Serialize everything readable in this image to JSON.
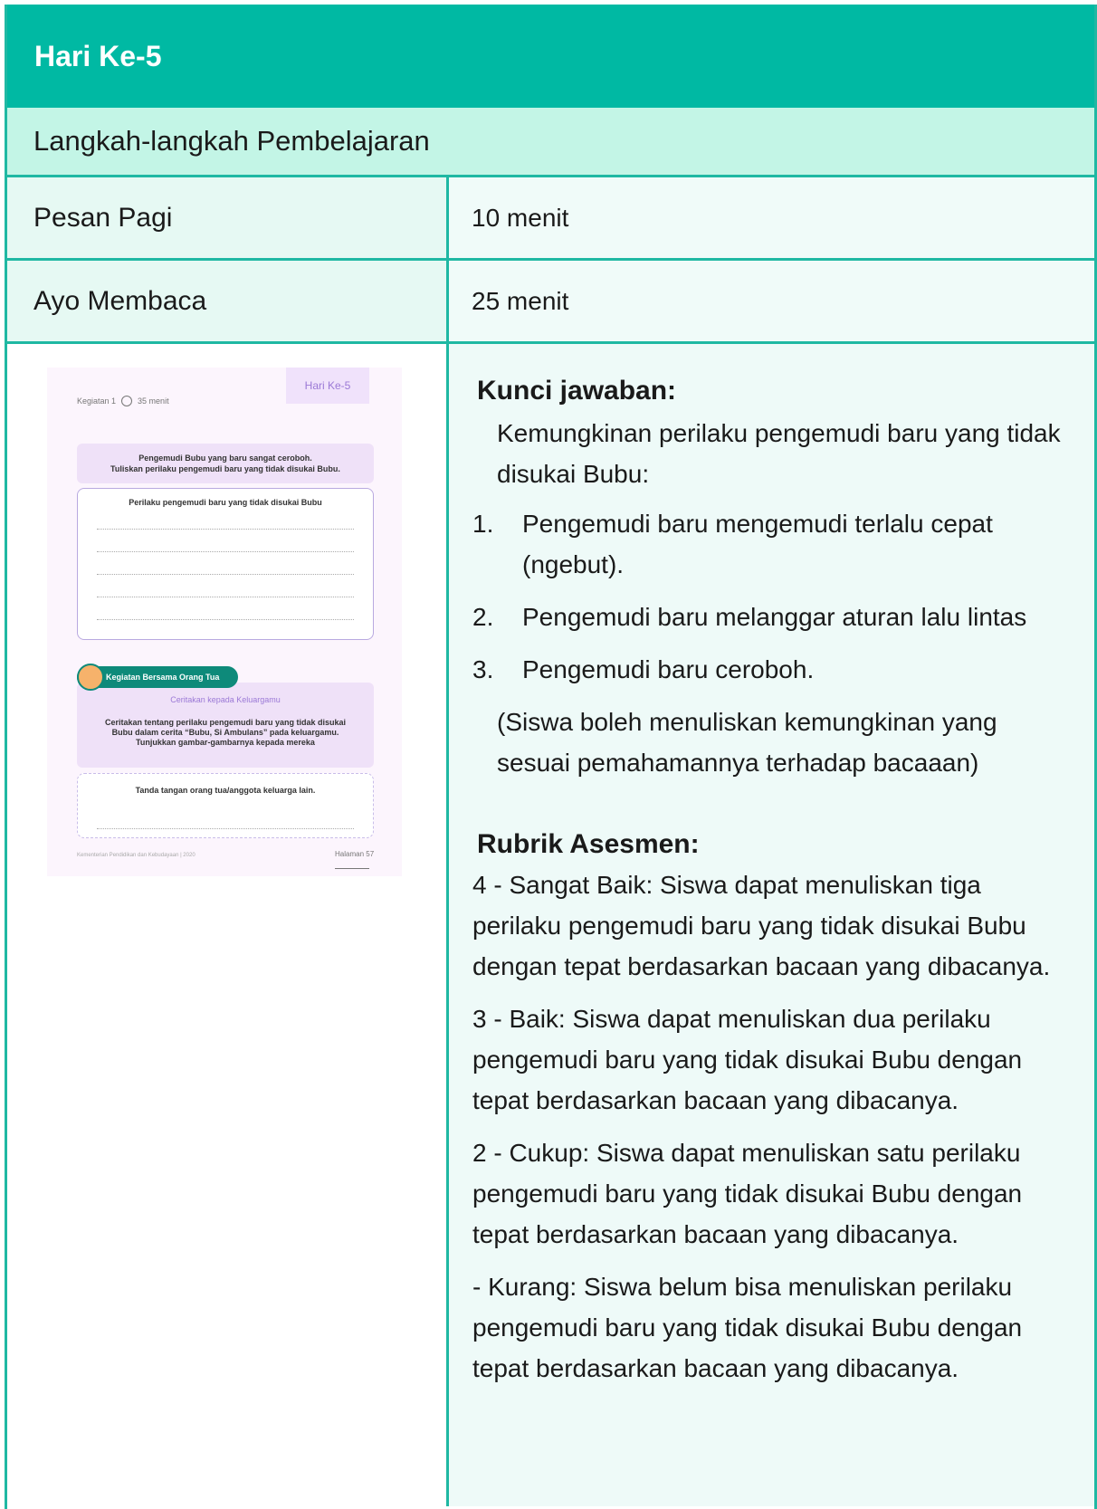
{
  "header": {
    "title": "Hari Ke-5"
  },
  "subheader": {
    "title": "Langkah-langkah Pembelajaran"
  },
  "rows": [
    {
      "label": "Pesan Pagi",
      "value": "10 menit"
    },
    {
      "label": "Ayo Membaca",
      "value": "25 menit"
    }
  ],
  "worksheet": {
    "day_tag": "Hari Ke-5",
    "activity": "Kegiatan 1",
    "duration": "35 menit",
    "instruction_line1": "Pengemudi Bubu yang baru sangat ceroboh.",
    "instruction_line2": "Tuliskan perilaku pengemudi baru yang tidak disukai Bubu.",
    "answer_box_title": "Perilaku pengemudi baru yang tidak disukai Bubu",
    "family_pill": "Kegiatan Bersama Orang Tua",
    "family_title": "Ceritakan kepada Keluargamu",
    "family_line1": "Ceritakan tentang perilaku pengemudi baru yang tidak disukai",
    "family_line2": "Bubu dalam cerita “Bubu, Si Ambulans” pada keluargamu.",
    "family_line3": "Tunjukkan gambar-gambarnya kepada mereka",
    "signature": "Tanda tangan orang tua/anggota keluarga lain.",
    "footer_left": "Kementerian Pendidikan dan Kebudayaan | 2020",
    "footer_right": "Halaman 57"
  },
  "answer_key": {
    "heading": "Kunci jawaban:",
    "intro": "Kemungkinan perilaku pengemudi baru yang tidak disukai Bubu:",
    "items": [
      {
        "num": "1.",
        "text": "Pengemudi baru mengemudi terlalu cepat (ngebut)."
      },
      {
        "num": "2.",
        "text": "Pengemudi baru melanggar aturan lalu lintas"
      },
      {
        "num": "3.",
        "text": "Pengemudi baru ceroboh."
      }
    ],
    "note": "(Siswa boleh menuliskan kemungkinan yang sesuai pemahamannya terhadap bacaaan)"
  },
  "rubric": {
    "heading": "Rubrik Asesmen:",
    "levels": [
      "4 - Sangat Baik: Siswa dapat menuliskan tiga perilaku pengemudi baru yang tidak disukai Bubu dengan tepat berdasarkan bacaan yang dibacanya.",
      "3 - Baik: Siswa dapat menuliskan dua perilaku pengemudi baru yang tidak disukai Bubu dengan tepat berdasarkan bacaan yang dibacanya.",
      "2 - Cukup: Siswa dapat menuliskan satu perilaku pengemudi baru yang tidak disukai Bubu dengan tepat berdasarkan bacaan yang dibacanya.",
      " - Kurang: Siswa belum bisa menuliskan perilaku pengemudi baru yang tidak disukai Bubu dengan tepat berdasarkan bacaan yang dibacanya."
    ]
  }
}
